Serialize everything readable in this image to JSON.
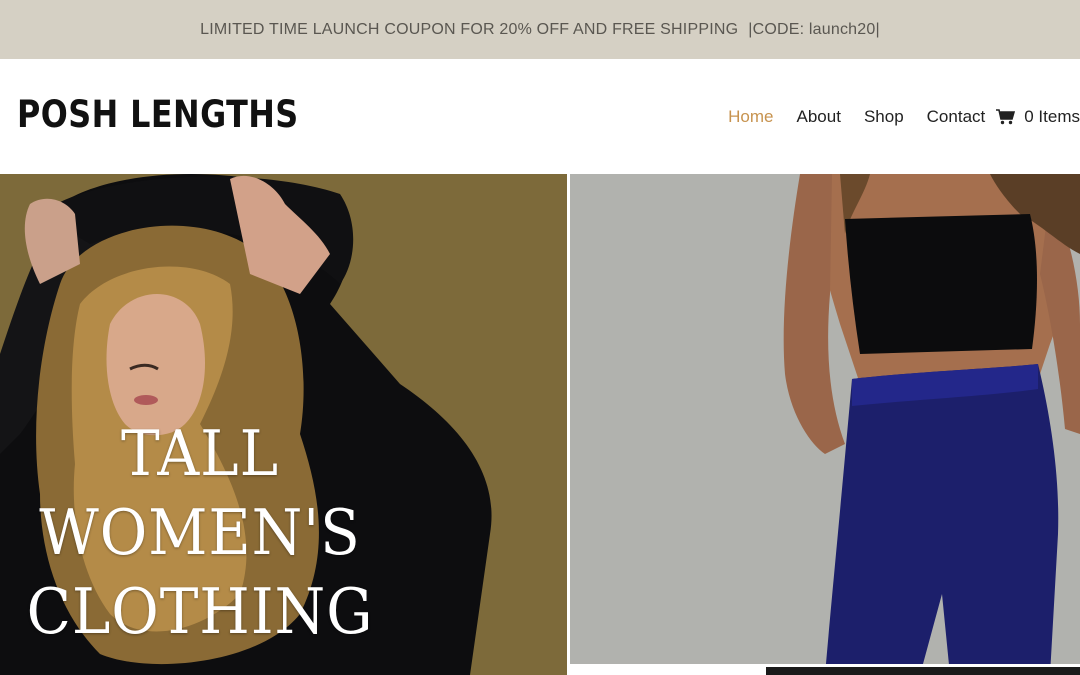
{
  "promo": {
    "text": "LIMITED TIME LAUNCH COUPON FOR 20% OFF AND FREE SHIPPING",
    "code": "|CODE: launch20|"
  },
  "header": {
    "logo": "POSH LENGTHS",
    "nav": [
      {
        "label": "Home",
        "active": true
      },
      {
        "label": "About"
      },
      {
        "label": "Shop"
      },
      {
        "label": "Contact"
      }
    ],
    "cart": {
      "icon": "cart-icon",
      "label": "0 Items"
    }
  },
  "hero": {
    "title_lines": [
      "TALL",
      "WOMEN'S",
      "CLOTHING"
    ]
  },
  "colors": {
    "promo_bg": "#d5d0c4",
    "accent": "#c7934f",
    "left_panel_bg": "#7d6a3a",
    "right_panel_bg": "#b1b2ae",
    "leggings": "#1c1f6b"
  }
}
